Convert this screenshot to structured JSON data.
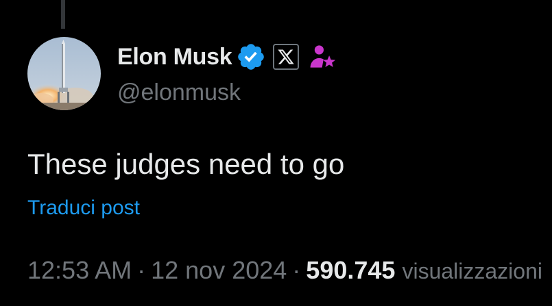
{
  "author": {
    "display_name": "Elon Musk",
    "handle": "@elonmusk",
    "avatar_icon": "rocket-launch-avatar",
    "verified_icon": "verified-badge-icon",
    "affiliate_icon": "x-logo-icon",
    "extra_icon": "profile-star-icon"
  },
  "post": {
    "text": "These judges need to go",
    "translate_label": "Traduci post"
  },
  "meta": {
    "time": "12:53 AM",
    "separator": "·",
    "date": "12 nov 2024",
    "views_count": "590.745",
    "views_label": "visualizzazioni"
  },
  "colors": {
    "background": "#000000",
    "primary_text": "#e7e9ea",
    "secondary_text": "#71767b",
    "link": "#1d9bf0",
    "verified": "#1d9bf0",
    "accent_magenta": "#c936cc"
  }
}
